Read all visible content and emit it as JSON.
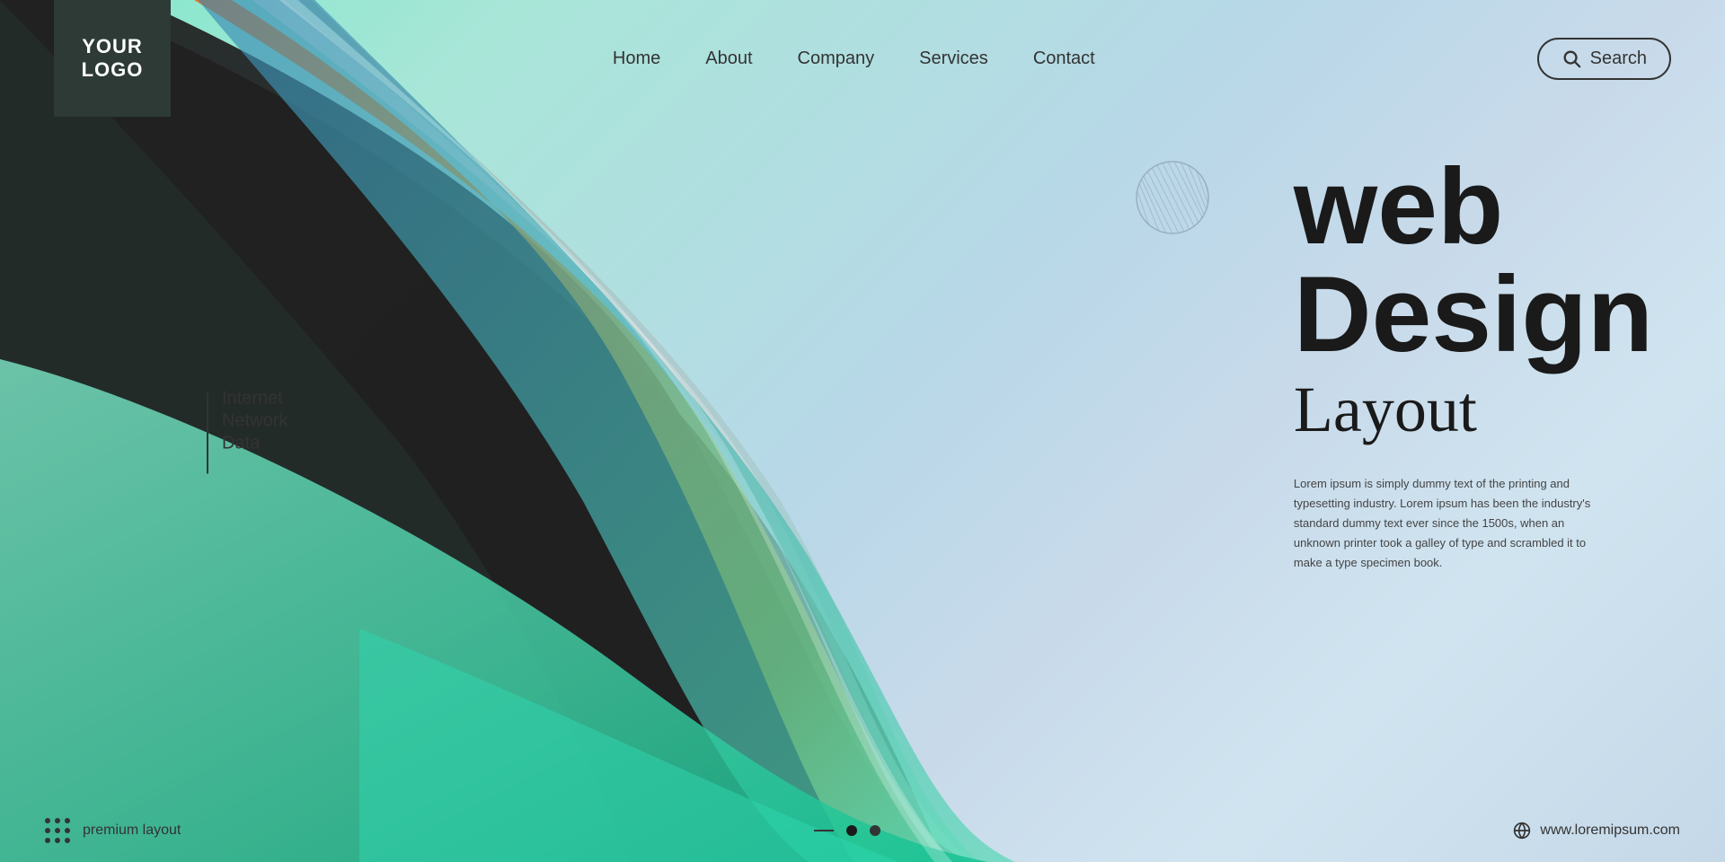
{
  "logo": {
    "line1": "YOUR",
    "line2": "LOGO"
  },
  "nav": {
    "links": [
      {
        "label": "Home",
        "id": "home"
      },
      {
        "label": "About",
        "id": "about"
      },
      {
        "label": "Company",
        "id": "company"
      },
      {
        "label": "Services",
        "id": "services"
      },
      {
        "label": "Contact",
        "id": "contact"
      }
    ]
  },
  "search": {
    "placeholder": "Search",
    "label": "Search"
  },
  "hero": {
    "line1": "web",
    "line2": "Design",
    "line3": "Layout",
    "description_line1": "Lorem ipsum is simply dummy text of the printing and typesetting industry. Lorem ipsum has",
    "description_line2": "been the industry's standard dummy text ever since the 1500s, when an unknown printer took a",
    "description_line3": "galley of type and scrambled it to make a type specimen book."
  },
  "sidebar": {
    "words": [
      "Internet",
      "Network",
      "Data"
    ]
  },
  "footer": {
    "premium_label": "premium layout",
    "website": "www.loremipsum.com"
  },
  "pagination": {
    "dots": [
      {
        "active": false,
        "type": "dash"
      },
      {
        "active": true,
        "type": "dot"
      },
      {
        "active": false,
        "type": "dot"
      }
    ]
  }
}
